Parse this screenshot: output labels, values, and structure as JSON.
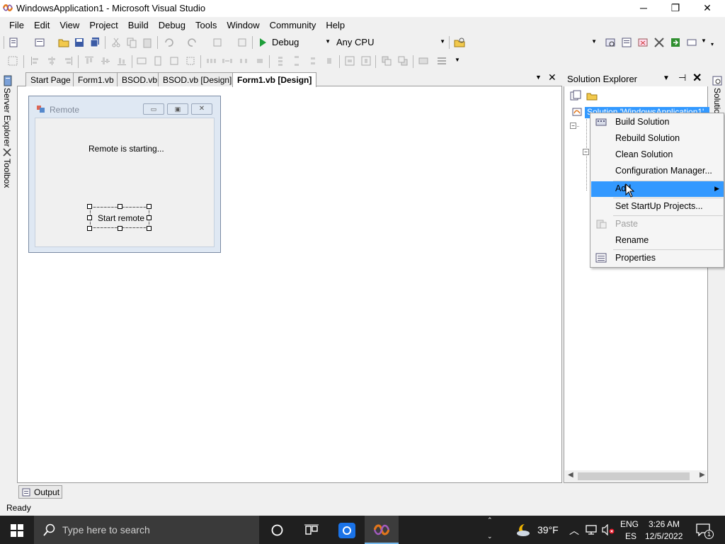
{
  "window": {
    "title": "WindowsApplication1 - Microsoft Visual Studio",
    "minimize": "─",
    "maximize": "❐",
    "close": "✕"
  },
  "menu": [
    "File",
    "Edit",
    "View",
    "Project",
    "Build",
    "Debug",
    "Tools",
    "Window",
    "Community",
    "Help"
  ],
  "toolbar": {
    "config": "Debug",
    "platform": "Any CPU"
  },
  "left_strip": {
    "server_explorer": "Server Explorer",
    "toolbox": "Toolbox"
  },
  "tabs": [
    "Start Page",
    "Form1.vb",
    "BSOD.vb",
    "BSOD.vb [Design]",
    "Form1.vb [Design]"
  ],
  "form": {
    "title": "Remote",
    "label": "Remote is starting...",
    "button": "Start remote"
  },
  "solution_explorer": {
    "title": "Solution Explorer",
    "root": "Solution 'WindowsApplication1'"
  },
  "right_strip": {
    "label": "Solution"
  },
  "context_menu": [
    {
      "label": "Build Solution",
      "icon": "build-solution-icon"
    },
    {
      "label": "Rebuild Solution",
      "icon": ""
    },
    {
      "label": "Clean Solution",
      "icon": ""
    },
    {
      "label": "Configuration Manager...",
      "icon": ""
    },
    {
      "label": "Add",
      "icon": "",
      "submenu": true,
      "highlighted": true
    },
    {
      "label": "Set StartUp Projects...",
      "icon": ""
    },
    {
      "label": "Paste",
      "icon": "paste-icon",
      "disabled": true
    },
    {
      "label": "Rename",
      "icon": ""
    },
    {
      "label": "Properties",
      "icon": "properties-icon"
    }
  ],
  "output_tab": "Output",
  "status": "Ready",
  "taskbar": {
    "search_placeholder": "Type here to search",
    "weather": "39°F",
    "lang_top": "ENG",
    "lang_bottom": "ES",
    "time": "3:26 AM",
    "date": "12/5/2022",
    "notifications": "1"
  }
}
